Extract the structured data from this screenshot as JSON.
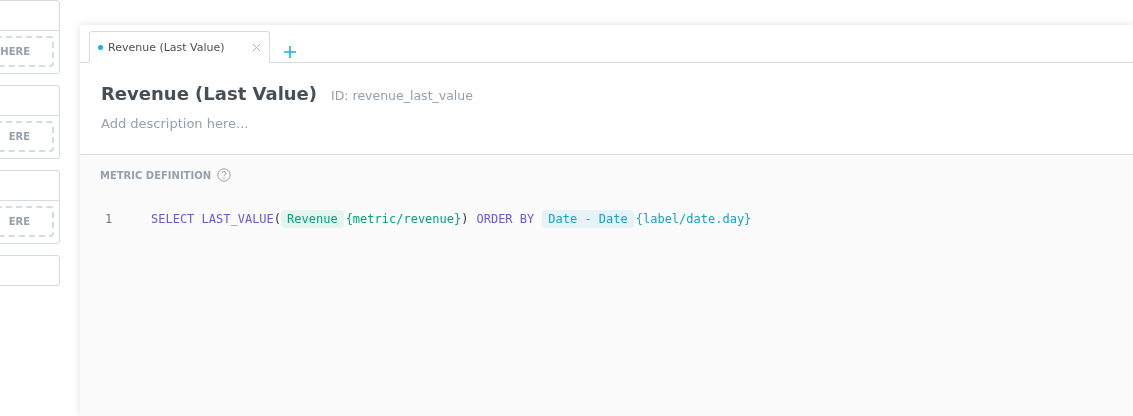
{
  "side_cards": [
    {
      "kind": "drop",
      "drop_zone": "HERE"
    },
    {
      "kind": "drop",
      "drop_zone": "ERE"
    },
    {
      "kind": "drop",
      "drop_zone": "ERE"
    },
    {
      "kind": "plain"
    }
  ],
  "tabs": [
    {
      "label": "Revenue (Last Value)",
      "selected": true,
      "unsaved": true
    }
  ],
  "metric": {
    "title": "Revenue (Last Value)",
    "id": "ID: revenue_last_value",
    "description": {
      "placeholder": "Add description here..."
    }
  },
  "definition": {
    "label": "METRIC DEFINITION",
    "lines": [
      {
        "number": "1",
        "tokens": [
          {
            "kind": "keyword",
            "text": "SELECT LAST_VALUE"
          },
          {
            "kind": "plain",
            "text": "("
          },
          {
            "kind": "metric",
            "text": "Revenue"
          },
          {
            "kind": "metric_ref",
            "text": "{metric/revenue}"
          },
          {
            "kind": "plain",
            "text": ")"
          },
          {
            "kind": "keyword",
            "text": "ORDER BY"
          },
          {
            "kind": "label",
            "text": "Date - Date"
          },
          {
            "kind": "label_ref",
            "text": "{label/date.day}"
          }
        ]
      }
    ]
  }
}
